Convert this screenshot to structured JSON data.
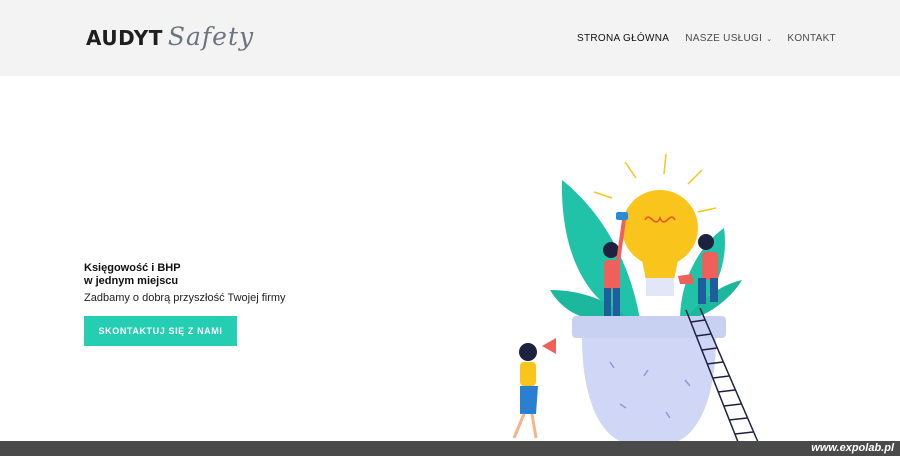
{
  "logo": {
    "main": "AUDYT",
    "script": "Safety"
  },
  "nav": {
    "home": "STRONA GŁÓWNA",
    "services": "NASZE USŁUGI",
    "contact": "KONTAKT"
  },
  "hero": {
    "title_line1": "Księgowość i BHP",
    "title_line2": "w jednym miejscu",
    "subtitle": "Zadbamy o dobrą przyszłość Twojej firmy",
    "cta_label": "SKONTAKTUJ SIĘ Z NAMI"
  },
  "footer": {
    "watermark": "www.expolab.pl"
  },
  "colors": {
    "accent": "#25cdb3",
    "header_bg": "#f3f3f3",
    "bulb": "#f9c41b",
    "leaf": "#20c3a7",
    "pot": "#cfd6f6",
    "footer_bg": "#4a4a4a"
  },
  "icons": {
    "dropdown": "chevron-down-icon"
  }
}
